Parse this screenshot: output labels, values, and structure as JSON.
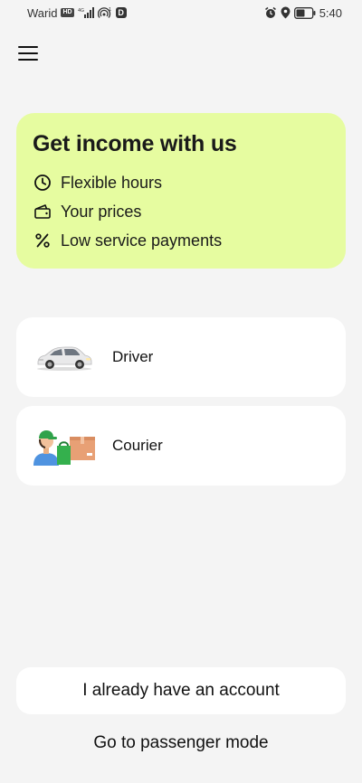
{
  "status_bar": {
    "carrier": "Warid",
    "time": "5:40",
    "icons": [
      "hd-badge",
      "signal-4g",
      "hotspot",
      "d-app",
      "alarm",
      "location",
      "battery"
    ]
  },
  "menu": {
    "icon": "hamburger-menu-icon"
  },
  "promo": {
    "title": "Get income with us",
    "items": [
      {
        "icon": "clock-icon",
        "label": "Flexible hours"
      },
      {
        "icon": "wallet-icon",
        "label": "Your prices"
      },
      {
        "icon": "percent-icon",
        "label": "Low service payments"
      }
    ],
    "background": "#e6fca0"
  },
  "roles": [
    {
      "label": "Driver",
      "illustration": "car-illustration"
    },
    {
      "label": "Courier",
      "illustration": "courier-illustration"
    }
  ],
  "actions": {
    "account_label": "I already have an account",
    "passenger_label": "Go to passenger mode"
  }
}
